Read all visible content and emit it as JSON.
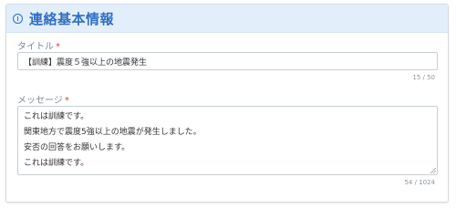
{
  "section": {
    "title": "連絡基本情報",
    "icon": "info-circle-icon",
    "accent_color": "#2f6fc2"
  },
  "title_field": {
    "label": "タイトル",
    "required_mark": "*",
    "value": "【訓練】震度５強以上の地震発生",
    "counter": "15 / 50"
  },
  "message_field": {
    "label": "メッセージ",
    "required_mark": "*",
    "lines": [
      "これは訓練です。",
      "関東地方で震度5強以上の地震が発生しました。",
      "安否の回答をお願いします。",
      "これは訓練です。"
    ],
    "counter": "54 / 1024"
  }
}
